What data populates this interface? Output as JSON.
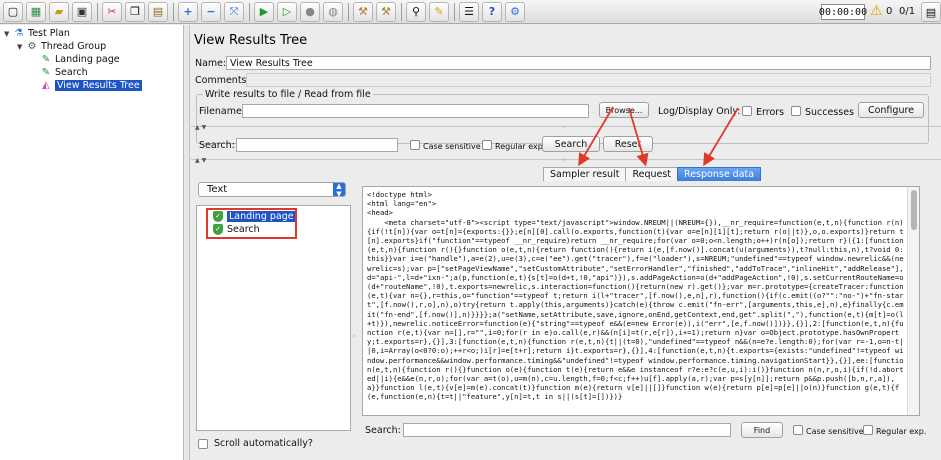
{
  "toolbar": {
    "icons": [
      "new-icon",
      "template-icon",
      "open-icon",
      "save-icon",
      "cut-icon",
      "copy-icon",
      "paste-icon",
      "expand-icon",
      "collapse-icon",
      "toggle-icon",
      "start-icon",
      "start-no-pause-icon",
      "stop-icon",
      "shutdown-icon",
      "clear-icon",
      "clear-all-icon",
      "search-icon",
      "reset-search-icon",
      "function-helper-icon",
      "help-icon",
      "remote-icon"
    ],
    "timer": "00:00:00",
    "warning_count": "0",
    "threads": "0/1"
  },
  "tree": {
    "items": [
      {
        "label": "Test Plan"
      },
      {
        "label": "Thread Group"
      },
      {
        "label": "Landing page"
      },
      {
        "label": "Search"
      },
      {
        "label": "View Results Tree"
      }
    ]
  },
  "panel": {
    "title": "View Results Tree",
    "name_label": "Name:",
    "name_value": "View Results Tree",
    "comments_label": "Comments:",
    "write_group_legend": "Write results to file / Read from file",
    "filename_label": "Filename",
    "browse_label": "Browse...",
    "log_display_label": "Log/Display Only:",
    "errors_label": "Errors",
    "successes_label": "Successes",
    "configure_label": "Configure",
    "search_label": "Search:",
    "case_sensitive_label": "Case sensitive",
    "regex_label": "Regular exp.",
    "search_button": "Search",
    "reset_button": "Reset"
  },
  "results": {
    "renderer": "Text",
    "samples": [
      {
        "label": "Landing page"
      },
      {
        "label": "Search"
      }
    ],
    "scroll_auto_label": "Scroll automatically?",
    "tabs": [
      "Sampler result",
      "Request",
      "Response data"
    ],
    "active_tab": "Response data",
    "response_text": "<!doctype html>\n<html lang=\"en\">\n<head>\n    <meta charset=\"utf-8\"><script type=\"text/javascript\">window.NREUM||(NREUM={}),__nr_require=function(e,t,n){function r(n){if(!t[n]){var o=t[n]={exports:{}};e[n][0].call(o.exports,function(t){var o=e[n][1][t];return r(o||t)},o,o.exports)}return t[n].exports}if(\"function\"==typeof __nr_require)return __nr_require;for(var o=0;o<n.length;o++)r(n[o]);return r}({1:[function(e,t,n){function r(){}function o(e,t,n){return function(){return i(e,[f.now()].concat(u(arguments)),t?null:this,n),t?void 0:this}}var i=e(\"handle\"),a=e(2),u=e(3),c=e(\"ee\").get(\"tracer\"),f=e(\"loader\"),s=NREUM;\"undefined\"==typeof window.newrelic&&(newrelic=s);var p=[\"setPageViewName\",\"setCustomAttribute\",\"setErrorHandler\",\"finished\",\"addToTrace\",\"inlineHit\",\"addRelease\"],d=\"api-\",l=d+\"ixn-\";a(p,function(e,t){s[t]=o(d+t,!0,\"api\")}),s.addPageAction=o(d+\"addPageAction\",!0),s.setCurrentRouteName=o(d+\"routeName\",!0),t.exports=newrelic,s.interaction=function(){return(new r).get()};var m=r.prototype={createTracer:function(e,t){var n={},r=this,o=\"function\"==typeof t;return i(l+\"tracer\",[f.now(),e,n],r),function(){if(c.emit((o?\"\":\"no-\")+\"fn-start\",[f.now(),r,o],n),o)try{return t.apply(this,arguments)}catch(e){throw c.emit(\"fn-err\",[arguments,this,e],n),e}finally{c.emit(\"fn-end\",[f.now()],n)}}}};a(\"setName,setAttribute,save,ignore,onEnd,getContext,end,get\".split(\",\"),function(e,t){m[t]=o(l+t)}),newrelic.noticeError=function(e){\"string\"==typeof e&&(e=new Error(e)),i(\"err\",[e,f.now()])}},{}],2:[function(e,t,n){function r(e,t){var n=[],r=\"\",i=0;for(r in e)o.call(e,r)&&(n[i]=t(r,e[r]),i+=1);return n}var o=Object.prototype.hasOwnProperty;t.exports=r},{}],3:[function(e,t,n){function r(e,t,n){t||(t=0),\"undefined\"==typeof n&&(n=e?e.length:0);for(var r=-1,o=n-t||0,i=Array(o<0?0:o);++r<o;)i[r]=e[t+r];return i}t.exports=r},{}],4:[function(e,t,n){t.exports={exists:\"undefined\"!=typeof window.performance&&window.performance.timing&&\"undefined\"!=typeof window.performance.timing.navigationStart}},{}],ee:[function(e,t,n){function r(){}function o(e){function t(e){return e&&e instanceof r?e:e?c(e,u,i):i()}function n(n,r,o,i){if(!d.aborted||i){e&&e(n,r,o);for(var a=t(o),u=m(n),c=u.length,f=0;f<c;f++)u[f].apply(a,r);var p=s[y[n]];return p&&p.push([b,n,r,a]),a}}function l(e,t){v[e]=m(e).concat(t)}function m(e){return v[e]||[]}function w(e){return p[e]=p[e]||o(n)}function g(e,t){f(e,function(e,n){t=t||\"feature\",y[n]=t,t in s||(s[t]=[])})}",
    "find_label": "Search:",
    "find_button": "Find",
    "find_case_label": "Case sensitive",
    "find_regex_label": "Regular exp."
  },
  "colors": {
    "accent": "#1d55c7",
    "annotation": "#e0392b",
    "success": "#3ea23e"
  }
}
